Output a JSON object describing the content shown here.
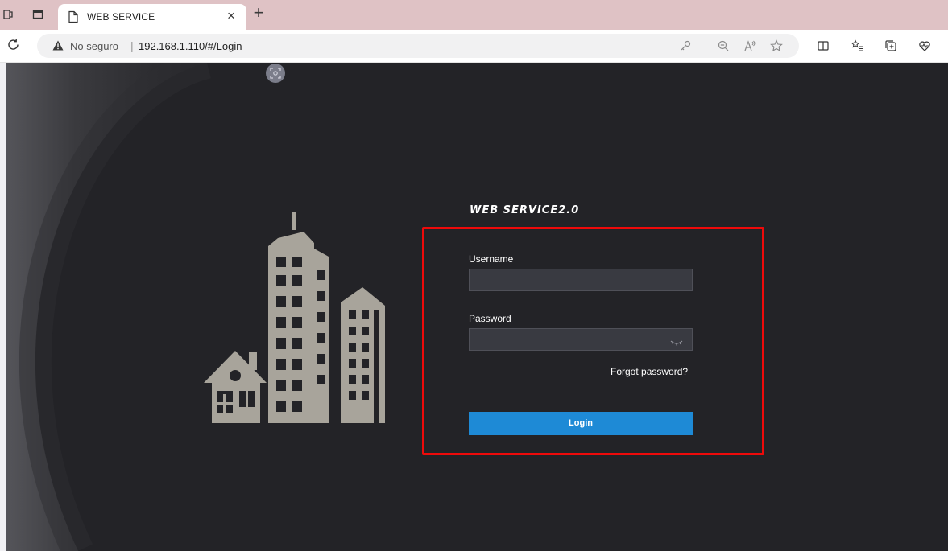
{
  "browser": {
    "tab_title": "WEB SERVICE",
    "tab_close": "×",
    "new_tab": "+",
    "minimize": "—",
    "security_label": "No seguro",
    "separator": "|",
    "url": "192.168.1.110/#/Login"
  },
  "page": {
    "brand_title": "WEB SERVICE2.0",
    "username_label": "Username",
    "username_value": "",
    "password_label": "Password",
    "password_value": "",
    "forgot_password": "Forgot password?",
    "login_button": "Login",
    "colors": {
      "background": "#232327",
      "accent": "#1e8ad6",
      "highlight": "#ee0a0a",
      "illustration": "#a8a49b"
    }
  }
}
